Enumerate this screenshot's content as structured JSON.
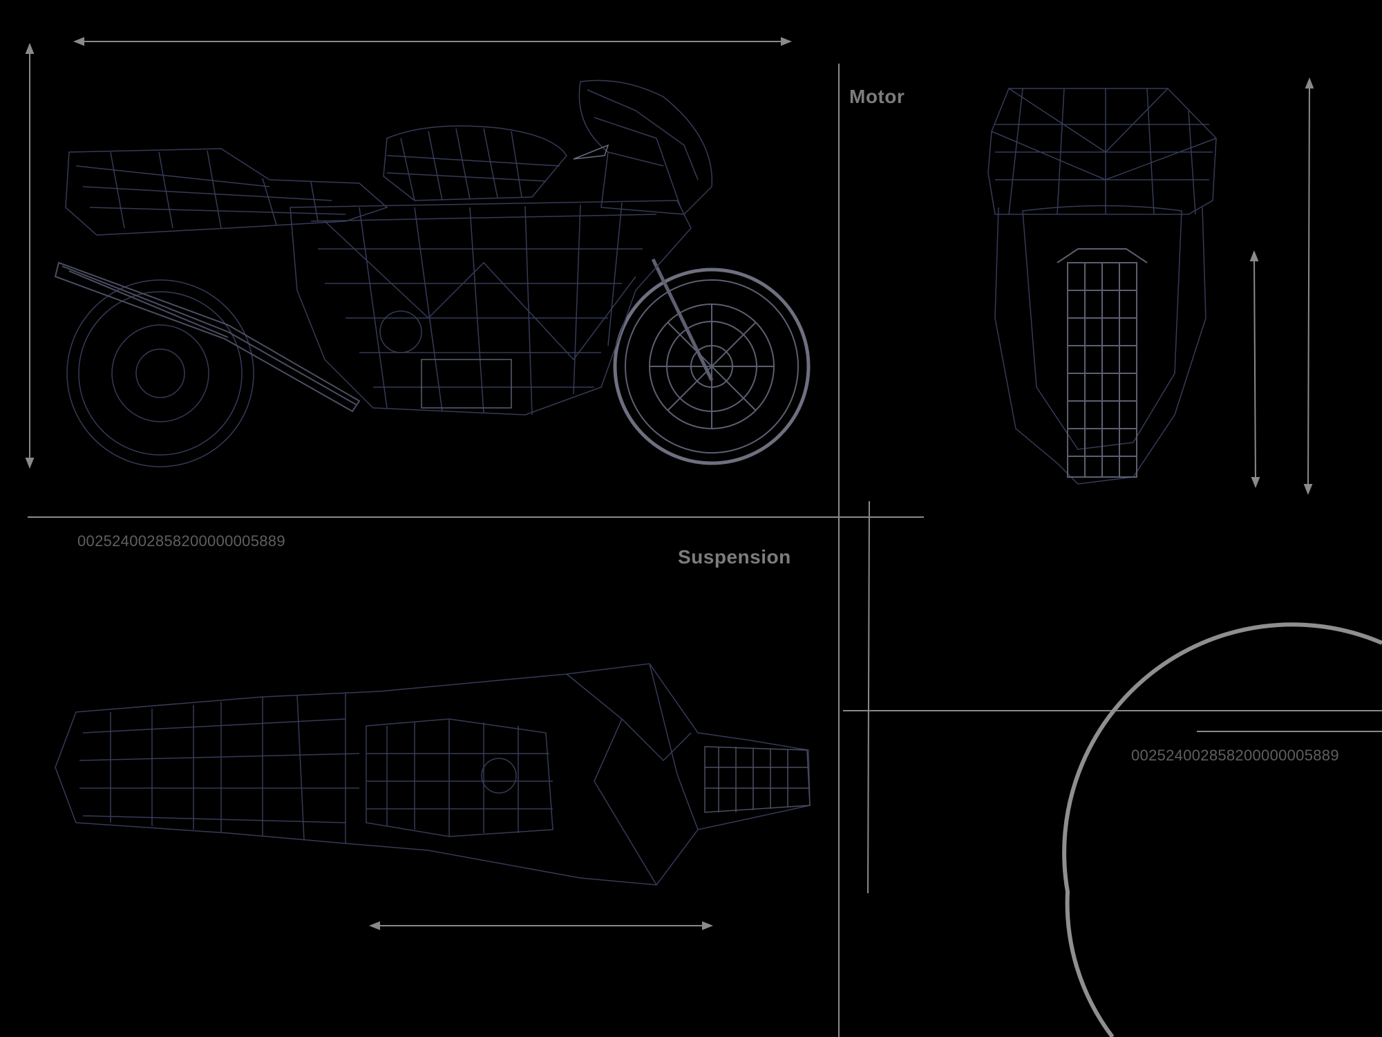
{
  "labels": {
    "motor": "Motor",
    "suspension": "Suspension",
    "part_code_top": "002524002858200000005889",
    "part_code_bottom": "002524002858200000005889"
  },
  "colors": {
    "background": "#000000",
    "line": "#8a8a8a",
    "wire": "#3a3f5c",
    "wire_highlight": "#6a6d80",
    "text": "#7d7d7d"
  },
  "views": [
    "side-view",
    "front-view",
    "top-view"
  ]
}
